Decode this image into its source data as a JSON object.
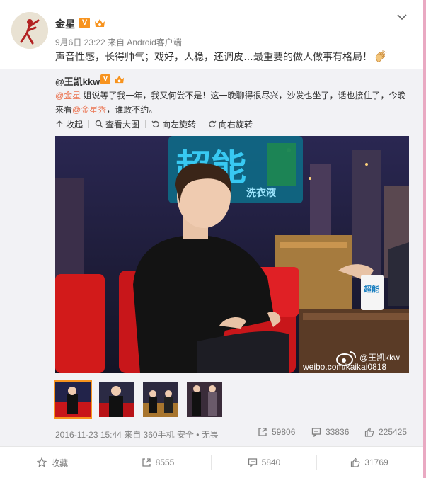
{
  "post": {
    "author": "金星",
    "verified_badge": "V",
    "meta": "9月6日 23:22 来自 Android客户端",
    "text": "声音性感，长得帅气；戏好，人稳，还调皮…最重要的做人做事有格局！",
    "icons": {
      "avatar": "dancer-avatar",
      "menu": "chevron-down-icon",
      "emoji": "clap-icon"
    }
  },
  "repost": {
    "author": "@王凯kkw",
    "verified_badge": "V",
    "text_parts": {
      "m1": "@金星",
      "t1": " 姐说等了我一年，我又何尝不是！这一晚聊得很尽兴，沙发也坐了，话也接住了，今晚来看",
      "m2": "@金星秀",
      "t2": "，谁敢不约。"
    },
    "tools": [
      {
        "label": "收起",
        "icon": "collapse-icon"
      },
      {
        "label": "查看大图",
        "icon": "zoom-icon"
      },
      {
        "label": "向左旋转",
        "icon": "rotate-left-icon"
      },
      {
        "label": "向右旋转",
        "icon": "rotate-right-icon"
      }
    ],
    "photo": {
      "sign_text": "超能",
      "sign_sub": "洗衣液",
      "cup_text": "超能",
      "watermark_name": "@王凯kkw",
      "watermark_url": "weibo.com/kaikai0818"
    },
    "thumbnail_count": 4,
    "date": "2016-11-23 15:44 来自 360手机 安全 • 无畏",
    "stats": {
      "reposts": "59806",
      "comments": "33836",
      "likes": "225425"
    }
  },
  "actions": {
    "favorite": "收藏",
    "repost": "8555",
    "comment": "5840",
    "like": "31769"
  },
  "colors": {
    "brand_orange": "#f7931e",
    "mention": "#eb7350",
    "repost_bg": "#f2f2f5",
    "page_edge": "#e9a9c2"
  }
}
